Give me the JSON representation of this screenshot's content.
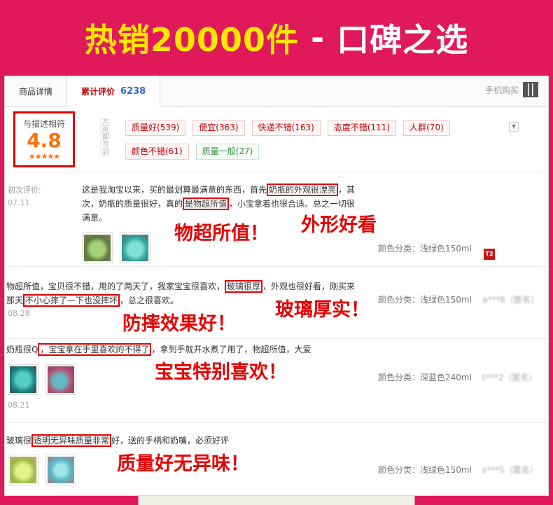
{
  "banner": {
    "title_part1": "热销20000件",
    "title_sep": " - ",
    "title_part2": "口碑之选"
  },
  "tabs": {
    "details": "商品详情",
    "reviews_label": "累计评价",
    "reviews_count": "6238",
    "mobile_buy": "手机购买"
  },
  "summary": {
    "score_label": "与描述相符",
    "score_value": "4.8",
    "score_stars": "★★★★★",
    "side_label": "大家都写到",
    "tags": [
      {
        "label": "质量好(539)"
      },
      {
        "label": "便宜(363)"
      },
      {
        "label": "快递不错(163)"
      },
      {
        "label": "态度不错(111)"
      },
      {
        "label": "人群(70)"
      },
      {
        "label": "颜色不错(61)"
      },
      {
        "label": "质量一般(27)"
      }
    ]
  },
  "reviews": [
    {
      "type": "初次评价:",
      "date": "07.11",
      "text_a": "这是我淘宝以来，买的最划算最满意的东西，首先",
      "hl_1": "奶瓶的外观很漂亮",
      "text_b": "，其次，奶瓶的质量很好，真的",
      "hl_2": "是物超所值",
      "text_c": "，小宝拿着也很合适。总之一切很满意。",
      "spec": "颜色分类：浅绿色150ml",
      "badge": "T2",
      "overlay_1": "物超所值！",
      "overlay_2": "外形好看"
    },
    {
      "text_a": "物超所值，宝贝很不错，用的了两天了，我家宝宝很喜欢，",
      "hl_1": "玻璃很厚",
      "text_b": "，外观也很好看，刚买来那天",
      "hl_2": "不小心摔了一下也没摔坏",
      "text_c": "，总之很喜欢。",
      "date": "08.28",
      "spec": "颜色分类：浅绿色150ml",
      "user": "a***6（匿名）",
      "overlay_1": "玻璃厚实！",
      "overlay_2": "防摔效果好！"
    },
    {
      "text_a": "奶瓶很Q",
      "hl_1": "，宝宝拿在手里喜欢的不得了",
      "text_b": "，拿到手就开水煮了用了，物超所值，大爱",
      "date": "08.21",
      "spec": "颜色分类：深蓝色240ml",
      "user": "t***2（匿名）",
      "overlay_1": "宝宝特别喜欢！"
    },
    {
      "text_a": "玻璃很",
      "hl_1": "透明无异味质量非常",
      "text_b": "好，送的手柄和奶嘴，必须好评",
      "spec": "颜色分类：浅绿色150ml",
      "user": "s***5（匿名）",
      "overlay_1": "质量好无异味！"
    }
  ]
}
